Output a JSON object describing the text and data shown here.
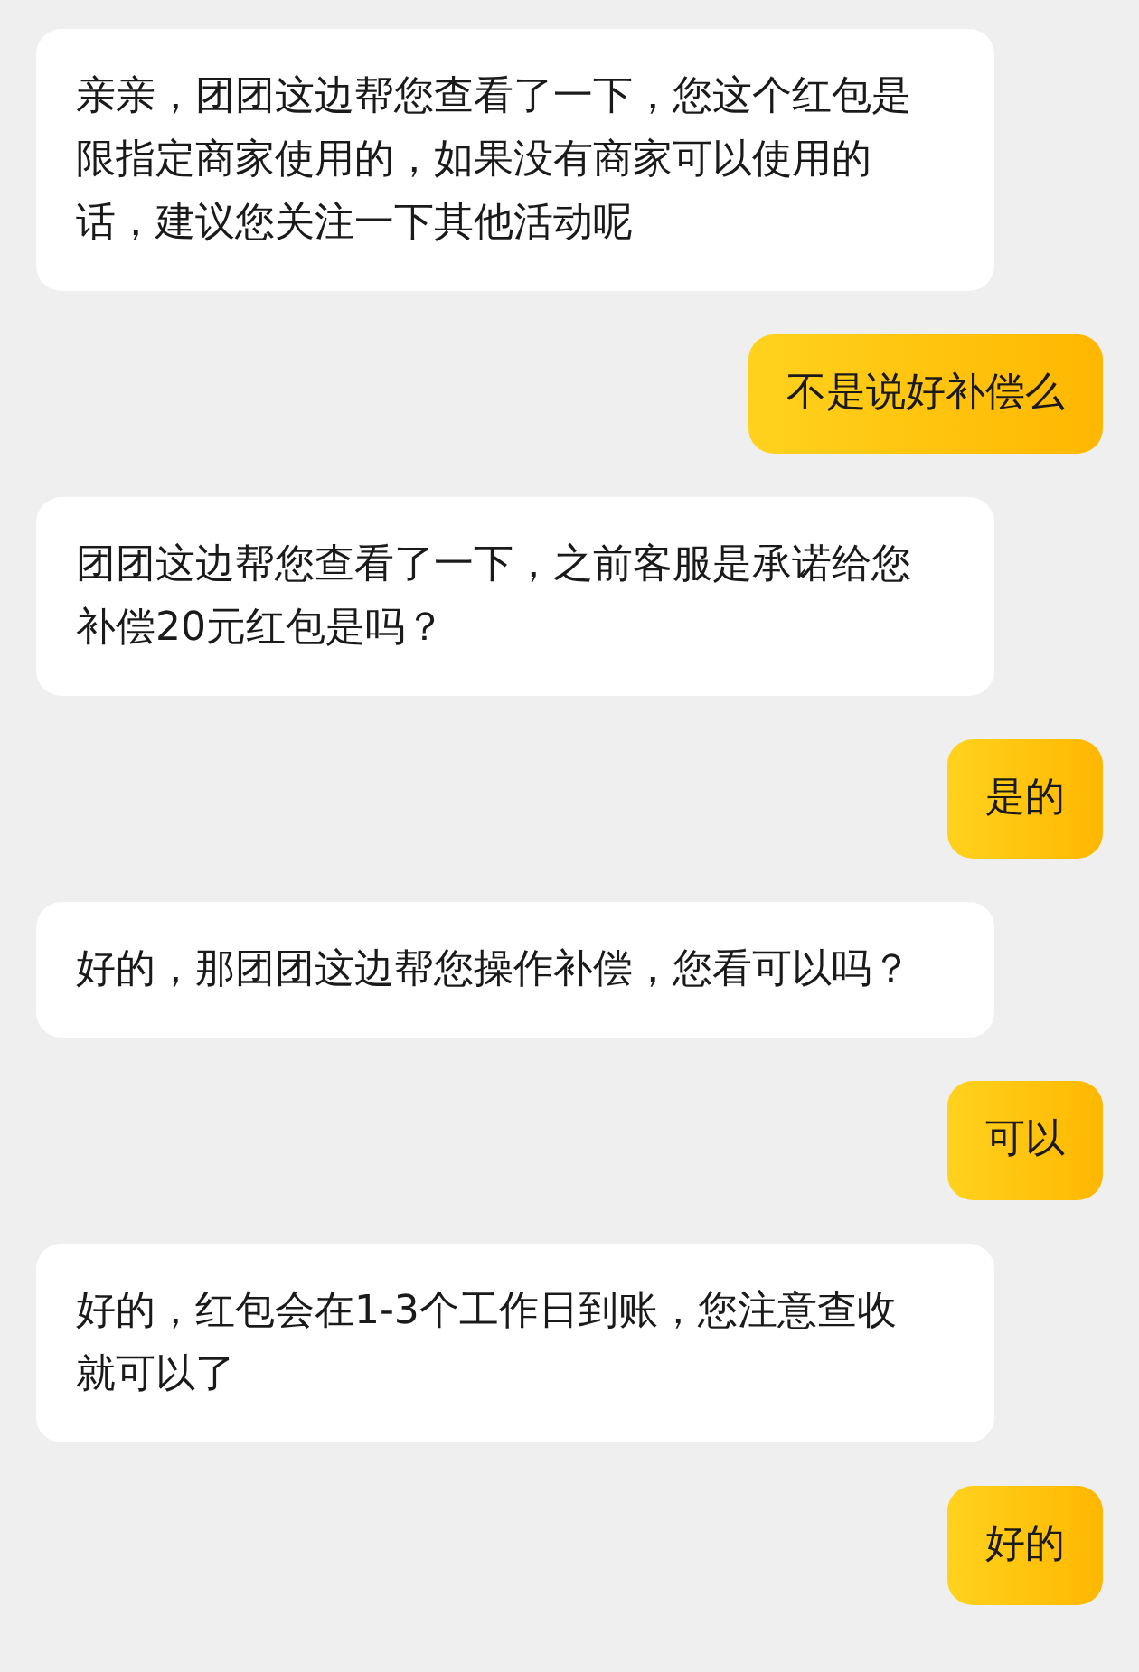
{
  "messages": [
    {
      "kind": "received",
      "text": "亲亲，团团这边帮您查看了一下，您这个红包是限指定商家使用的，如果没有商家可以使用的话，建议您关注一下其他活动呢"
    },
    {
      "kind": "sent",
      "text": "不是说好补偿么"
    },
    {
      "kind": "received",
      "text": "团团这边帮您查看了一下，之前客服是承诺给您补偿20元红包是吗？"
    },
    {
      "kind": "sent",
      "text": "是的"
    },
    {
      "kind": "received",
      "text": "好的，那团团这边帮您操作补偿，您看可以吗？"
    },
    {
      "kind": "sent",
      "text": "可以"
    },
    {
      "kind": "received",
      "text": "好的，红包会在1-3个工作日到账，您注意查收就可以了"
    },
    {
      "kind": "sent",
      "text": "好的"
    }
  ]
}
